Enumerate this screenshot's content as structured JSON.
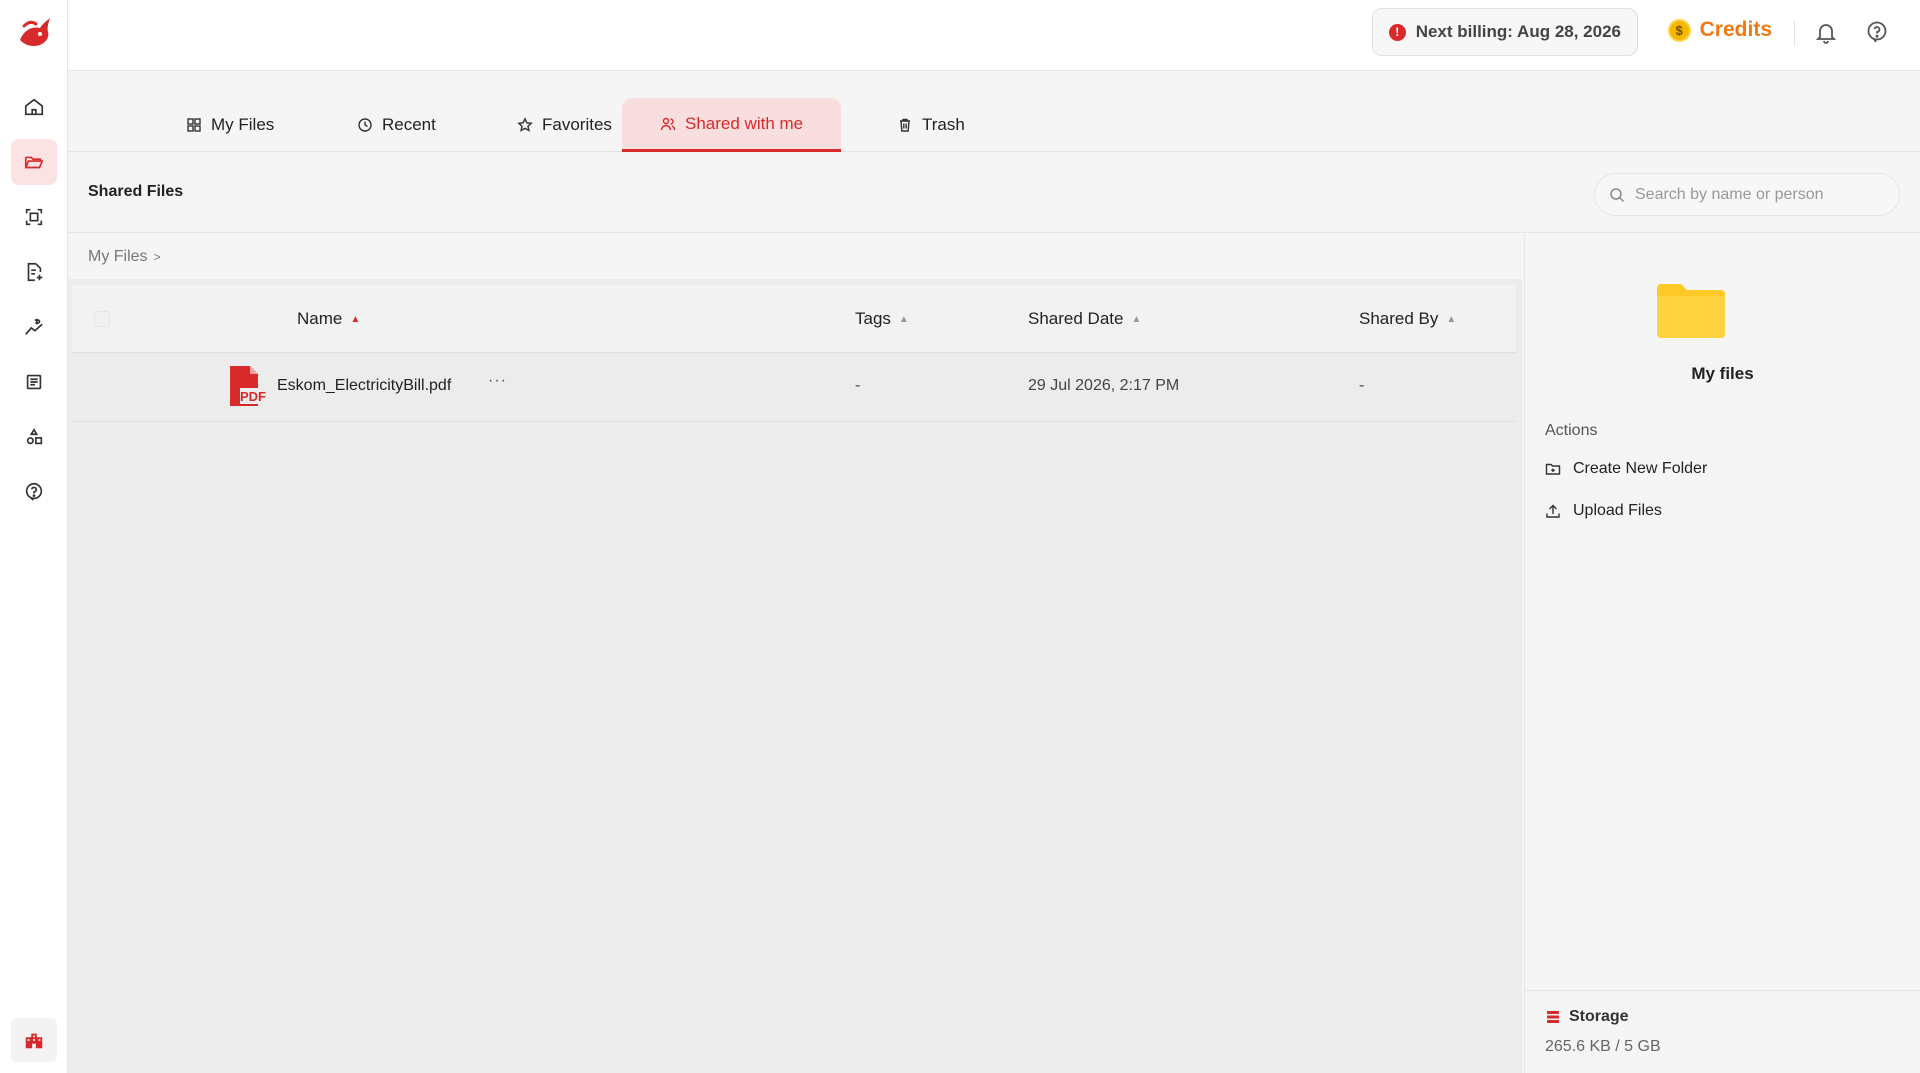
{
  "topbar": {
    "billing": "Next billing: Aug 28, 2026",
    "credits": "Credits",
    "coin_symbol": "$"
  },
  "sidebar": {
    "items": [
      {
        "icon": "home-icon"
      },
      {
        "icon": "folder-icon",
        "active": true
      },
      {
        "icon": "scan-icon"
      },
      {
        "icon": "document-add-icon"
      },
      {
        "icon": "finance-chart-icon"
      },
      {
        "icon": "list-icon"
      },
      {
        "icon": "shapes-icon"
      },
      {
        "icon": "help-icon"
      }
    ],
    "bottom": {
      "icon": "building-icon"
    }
  },
  "tabs": [
    {
      "label": "My Files",
      "icon": "grid-icon"
    },
    {
      "label": "Recent",
      "icon": "clock-icon"
    },
    {
      "label": "Favorites",
      "icon": "star-icon"
    },
    {
      "label": "Shared with me",
      "icon": "users-icon",
      "active": true
    },
    {
      "label": "Trash",
      "icon": "trash-icon"
    }
  ],
  "section": {
    "title": "Shared Files",
    "search_placeholder": "Search by name or person"
  },
  "breadcrumb": {
    "item": "My Files",
    "separator": ">"
  },
  "table": {
    "columns": [
      "Name",
      "Tags",
      "Shared Date",
      "Shared By"
    ],
    "rows": [
      {
        "name": "Eskom_ElectricityBill.pdf",
        "tags": "-",
        "shared_date": "29 Jul 2026, 2:17 PM",
        "shared_by": "-",
        "more": "···",
        "file_type": "PDF"
      }
    ]
  },
  "panel": {
    "title": "My files",
    "actions_label": "Actions",
    "actions": [
      "Create New Folder",
      "Upload Files"
    ],
    "storage_label": "Storage",
    "storage_value": "265.6 KB / 5 GB"
  },
  "colors": {
    "accent": "#d82a2a",
    "credits": "#f07a12",
    "folder": "#ffc928"
  }
}
